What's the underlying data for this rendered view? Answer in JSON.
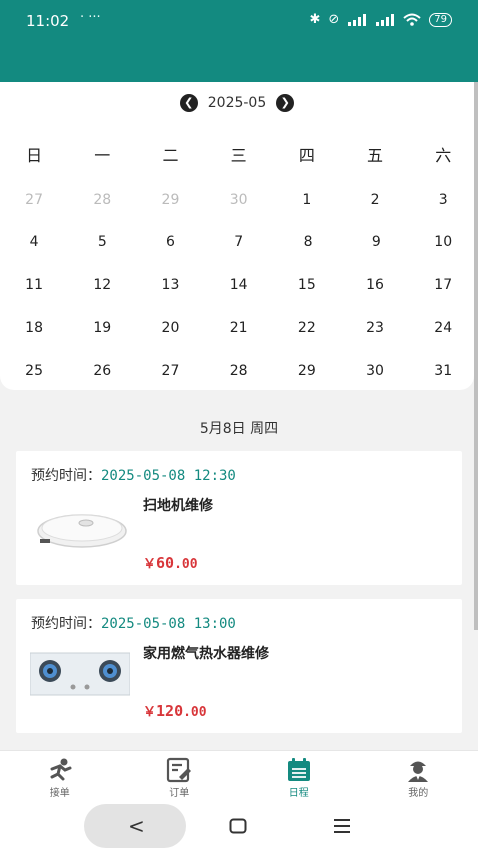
{
  "status_bar": {
    "time": "11:02",
    "extra": "·  ···",
    "battery": "79"
  },
  "calendar": {
    "month": "2025-05",
    "weekdays": [
      "日",
      "一",
      "二",
      "三",
      "四",
      "五",
      "六"
    ],
    "weeks": [
      [
        "27",
        "28",
        "29",
        "30",
        "1",
        "2",
        "3"
      ],
      [
        "4",
        "5",
        "6",
        "7",
        "8",
        "9",
        "10"
      ],
      [
        "11",
        "12",
        "13",
        "14",
        "15",
        "16",
        "17"
      ],
      [
        "18",
        "19",
        "20",
        "21",
        "22",
        "23",
        "24"
      ],
      [
        "25",
        "26",
        "27",
        "28",
        "29",
        "30",
        "31"
      ]
    ],
    "marked_days": [
      "8",
      "9"
    ]
  },
  "selected_date": "5月8日  周四",
  "orders": [
    {
      "time_label": "预约时间：",
      "time": "2025-05-08 12:30",
      "title": "扫地机维修",
      "currency": "￥",
      "price": "60",
      "decimals": ".00",
      "image_icon": "robot-vacuum"
    },
    {
      "time_label": "预约时间：",
      "time": "2025-05-08 13:00",
      "title": "家用燃气热水器维修",
      "currency": "￥",
      "price": "120",
      "decimals": ".00",
      "image_icon": "gas-stove"
    }
  ],
  "tabs": [
    {
      "label": "接单",
      "icon": "runner-icon"
    },
    {
      "label": "订单",
      "icon": "order-icon"
    },
    {
      "label": "日程",
      "icon": "calendar-icon"
    },
    {
      "label": "我的",
      "icon": "profile-icon"
    }
  ],
  "colors": {
    "primary": "#138a80",
    "price": "#d8363a",
    "marker": "#e8823c"
  }
}
